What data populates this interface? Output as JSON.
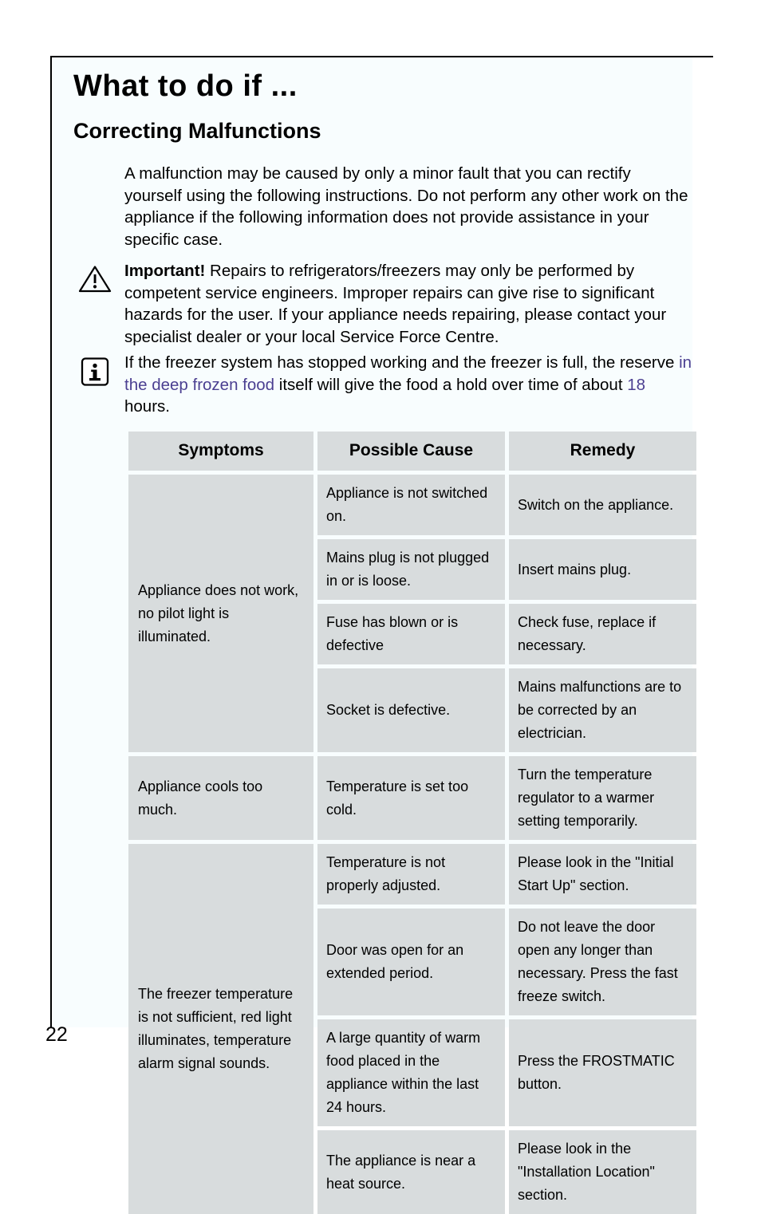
{
  "page": {
    "number": "22",
    "title": "What to do if ...",
    "subtitle": "Correcting Malfunctions"
  },
  "intro": {
    "text": "A malfunction may be caused by only a minor fault that you can rectify yourself using the following instructions. Do not perform any other work on the appliance if the following information does not provide assistance in your specific case."
  },
  "important_note": {
    "icon": "warning-triangle-icon",
    "lead": "Important!",
    "text": " Repairs to refrigerators/freezers may only be performed by competent service engineers. Improper repairs can give rise to significant hazards for the user. If your appliance needs repairing, please contact your specialist dealer or your local Service Force Centre."
  },
  "info_note": {
    "icon": "info-icon",
    "part1": "If the freezer system has stopped working and the freezer is full, the reserve ",
    "highlight1": "in the deep frozen food",
    "part2": " itself will give the food a hold over time of about ",
    "highlight2": "18",
    "part3": " hours.",
    "accent_color": "#4b3f91"
  },
  "table": {
    "headers": [
      "Symptoms",
      "Possible Cause",
      "Remedy"
    ],
    "groups": [
      {
        "symptom": "Appliance does not work, no pilot light is illuminated.",
        "rows": [
          {
            "cause": "Appliance is not switched on.",
            "remedy": "Switch on the appliance."
          },
          {
            "cause": "Mains plug is not plugged in or is loose.",
            "remedy": "Insert mains plug."
          },
          {
            "cause": "Fuse has blown or is defective",
            "remedy": "Check fuse, replace if necessary."
          },
          {
            "cause": "Socket is defective.",
            "remedy": "Mains malfunctions are to be corrected by an electrician."
          }
        ]
      },
      {
        "symptom": "Appliance cools too much.",
        "rows": [
          {
            "cause": "Temperature is set too cold.",
            "remedy": "Turn the temperature regulator to a warmer setting temporarily."
          }
        ]
      },
      {
        "symptom": "The freezer temperature is not sufficient, red light illuminates, temperature alarm signal sounds.",
        "rows": [
          {
            "cause": "Temperature is not properly adjusted.",
            "remedy": "Please look in the \"Initial Start Up\" section."
          },
          {
            "cause": "Door was open for an extended period.",
            "remedy": "Do not leave the door open any longer than necessary. Press the fast freeze switch."
          },
          {
            "cause": "A large quantity of warm food placed in the appliance within the last 24 hours.",
            "remedy": "Press the FROSTMATIC button."
          },
          {
            "cause": "The appliance is near a heat source.",
            "remedy": "Please look in the \"Installation Location\" section."
          }
        ]
      }
    ]
  }
}
